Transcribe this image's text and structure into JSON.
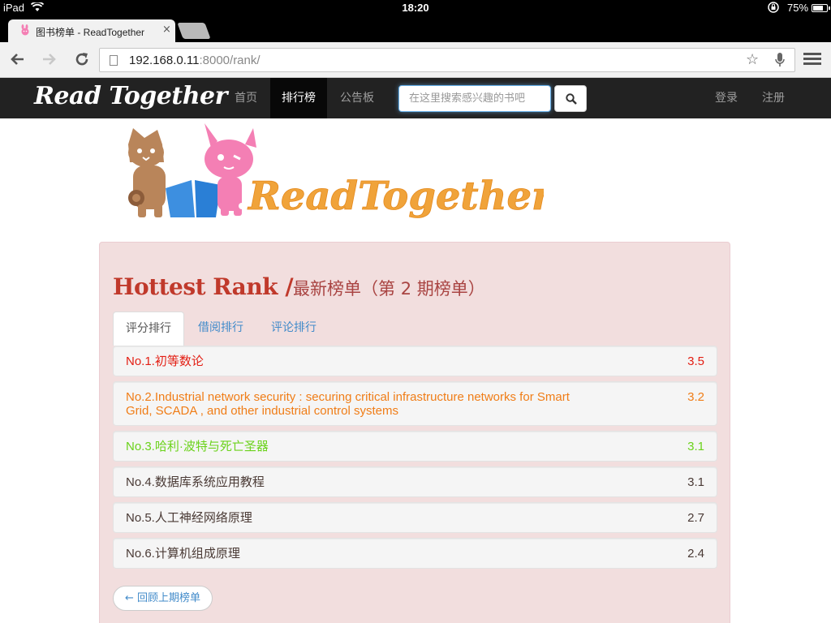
{
  "status_bar": {
    "device": "iPad",
    "time": "18:20",
    "battery": "75%",
    "battery_level": 0.75
  },
  "browser": {
    "tab_title": "图书榜单 - ReadTogether",
    "tab_close": "×",
    "url_host": "192.168.0.11",
    "url_path": ":8000/rank/"
  },
  "navbar": {
    "brand": "Read Together",
    "links": [
      "首页",
      "排行榜",
      "公告板"
    ],
    "active_link": "排行榜",
    "search_placeholder": "在这里搜索感兴趣的书吧",
    "login": "登录",
    "register": "注册"
  },
  "logo": {
    "text": "ReadTogether"
  },
  "rank": {
    "title_en": "Hottest Rank /",
    "title_zh": "最新榜单（第 2 期榜单）",
    "tabs": [
      "评分排行",
      "借阅排行",
      "评论排行"
    ],
    "active_tab": "评分排行",
    "items": [
      {
        "name": "No.1.初等数论",
        "score": "3.5",
        "color": "#e31e13"
      },
      {
        "name": "No.2.Industrial network security : securing critical infrastructure networks for Smart Grid, SCADA , and other industrial control systems",
        "score": "3.2",
        "color": "#f07d17"
      },
      {
        "name": "No.3.哈利·波特与死亡圣器",
        "score": "3.1",
        "color": "#6bd21b"
      },
      {
        "name": "No.4.数据库系统应用教程",
        "score": "3.1",
        "color": "#4a3a35"
      },
      {
        "name": "No.5.人工神经网络原理",
        "score": "2.7",
        "color": "#4a3a35"
      },
      {
        "name": "No.6.计算机组成原理",
        "score": "2.4",
        "color": "#4a3a35"
      }
    ],
    "back_button": "← 回顾上期榜单"
  },
  "colors": {
    "navbar_bg": "#222222",
    "panel_bg": "#f2dede",
    "link": "#428bca"
  }
}
